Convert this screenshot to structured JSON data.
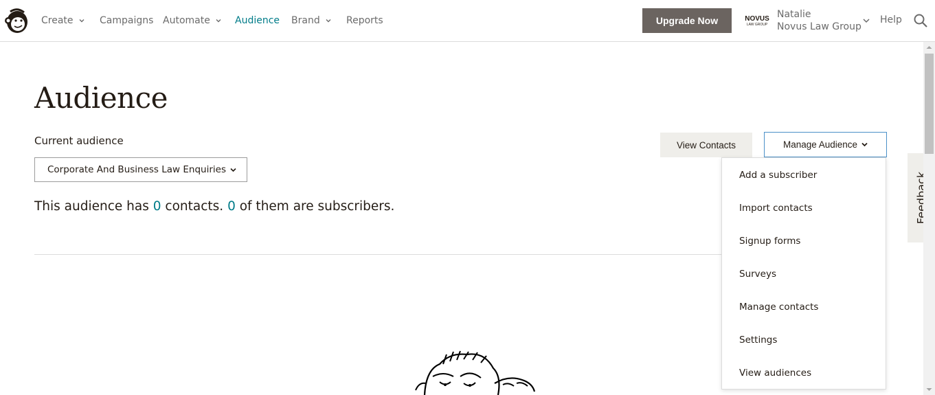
{
  "nav": {
    "items": [
      {
        "label": "Create",
        "has_menu": true,
        "active": false
      },
      {
        "label": "Campaigns",
        "has_menu": false,
        "active": false
      },
      {
        "label": "Automate",
        "has_menu": true,
        "active": false
      },
      {
        "label": "Audience",
        "has_menu": false,
        "active": true
      },
      {
        "label": "Brand",
        "has_menu": true,
        "active": false
      },
      {
        "label": "Reports",
        "has_menu": false,
        "active": false
      }
    ],
    "upgrade_label": "Upgrade Now",
    "account": {
      "user_name": "Natalie",
      "org_name": "Novus Law Group",
      "logo_text": "NOVUS",
      "logo_subtext": "LAW GROUP"
    },
    "help_label": "Help"
  },
  "main": {
    "title": "Audience",
    "current_audience_label": "Current audience",
    "selected_audience": "Corporate And Business Law Enquiries",
    "summary": {
      "prefix": "This audience has ",
      "contacts_count": "0",
      "middle": " contacts. ",
      "subscribers_count": "0",
      "suffix": " of them are subscribers."
    },
    "view_contacts_label": "View Contacts",
    "manage_audience_label": "Manage Audience",
    "manage_menu": [
      "Add a subscriber",
      "Import contacts",
      "Signup forms",
      "Surveys",
      "Manage contacts",
      "Settings",
      "View audiences"
    ]
  },
  "feedback_label": "Feedback",
  "colors": {
    "accent": "#007c89",
    "upgrade_bg": "#6b6460",
    "secondary_btn_bg": "#efeeea",
    "focus_border": "#4a90c8",
    "text": "#241c15",
    "nav_text": "#6b6b6b"
  },
  "icons": {
    "logo": "mailchimp-freddie-icon",
    "search": "search-icon",
    "chevron": "chevron-down-icon"
  }
}
